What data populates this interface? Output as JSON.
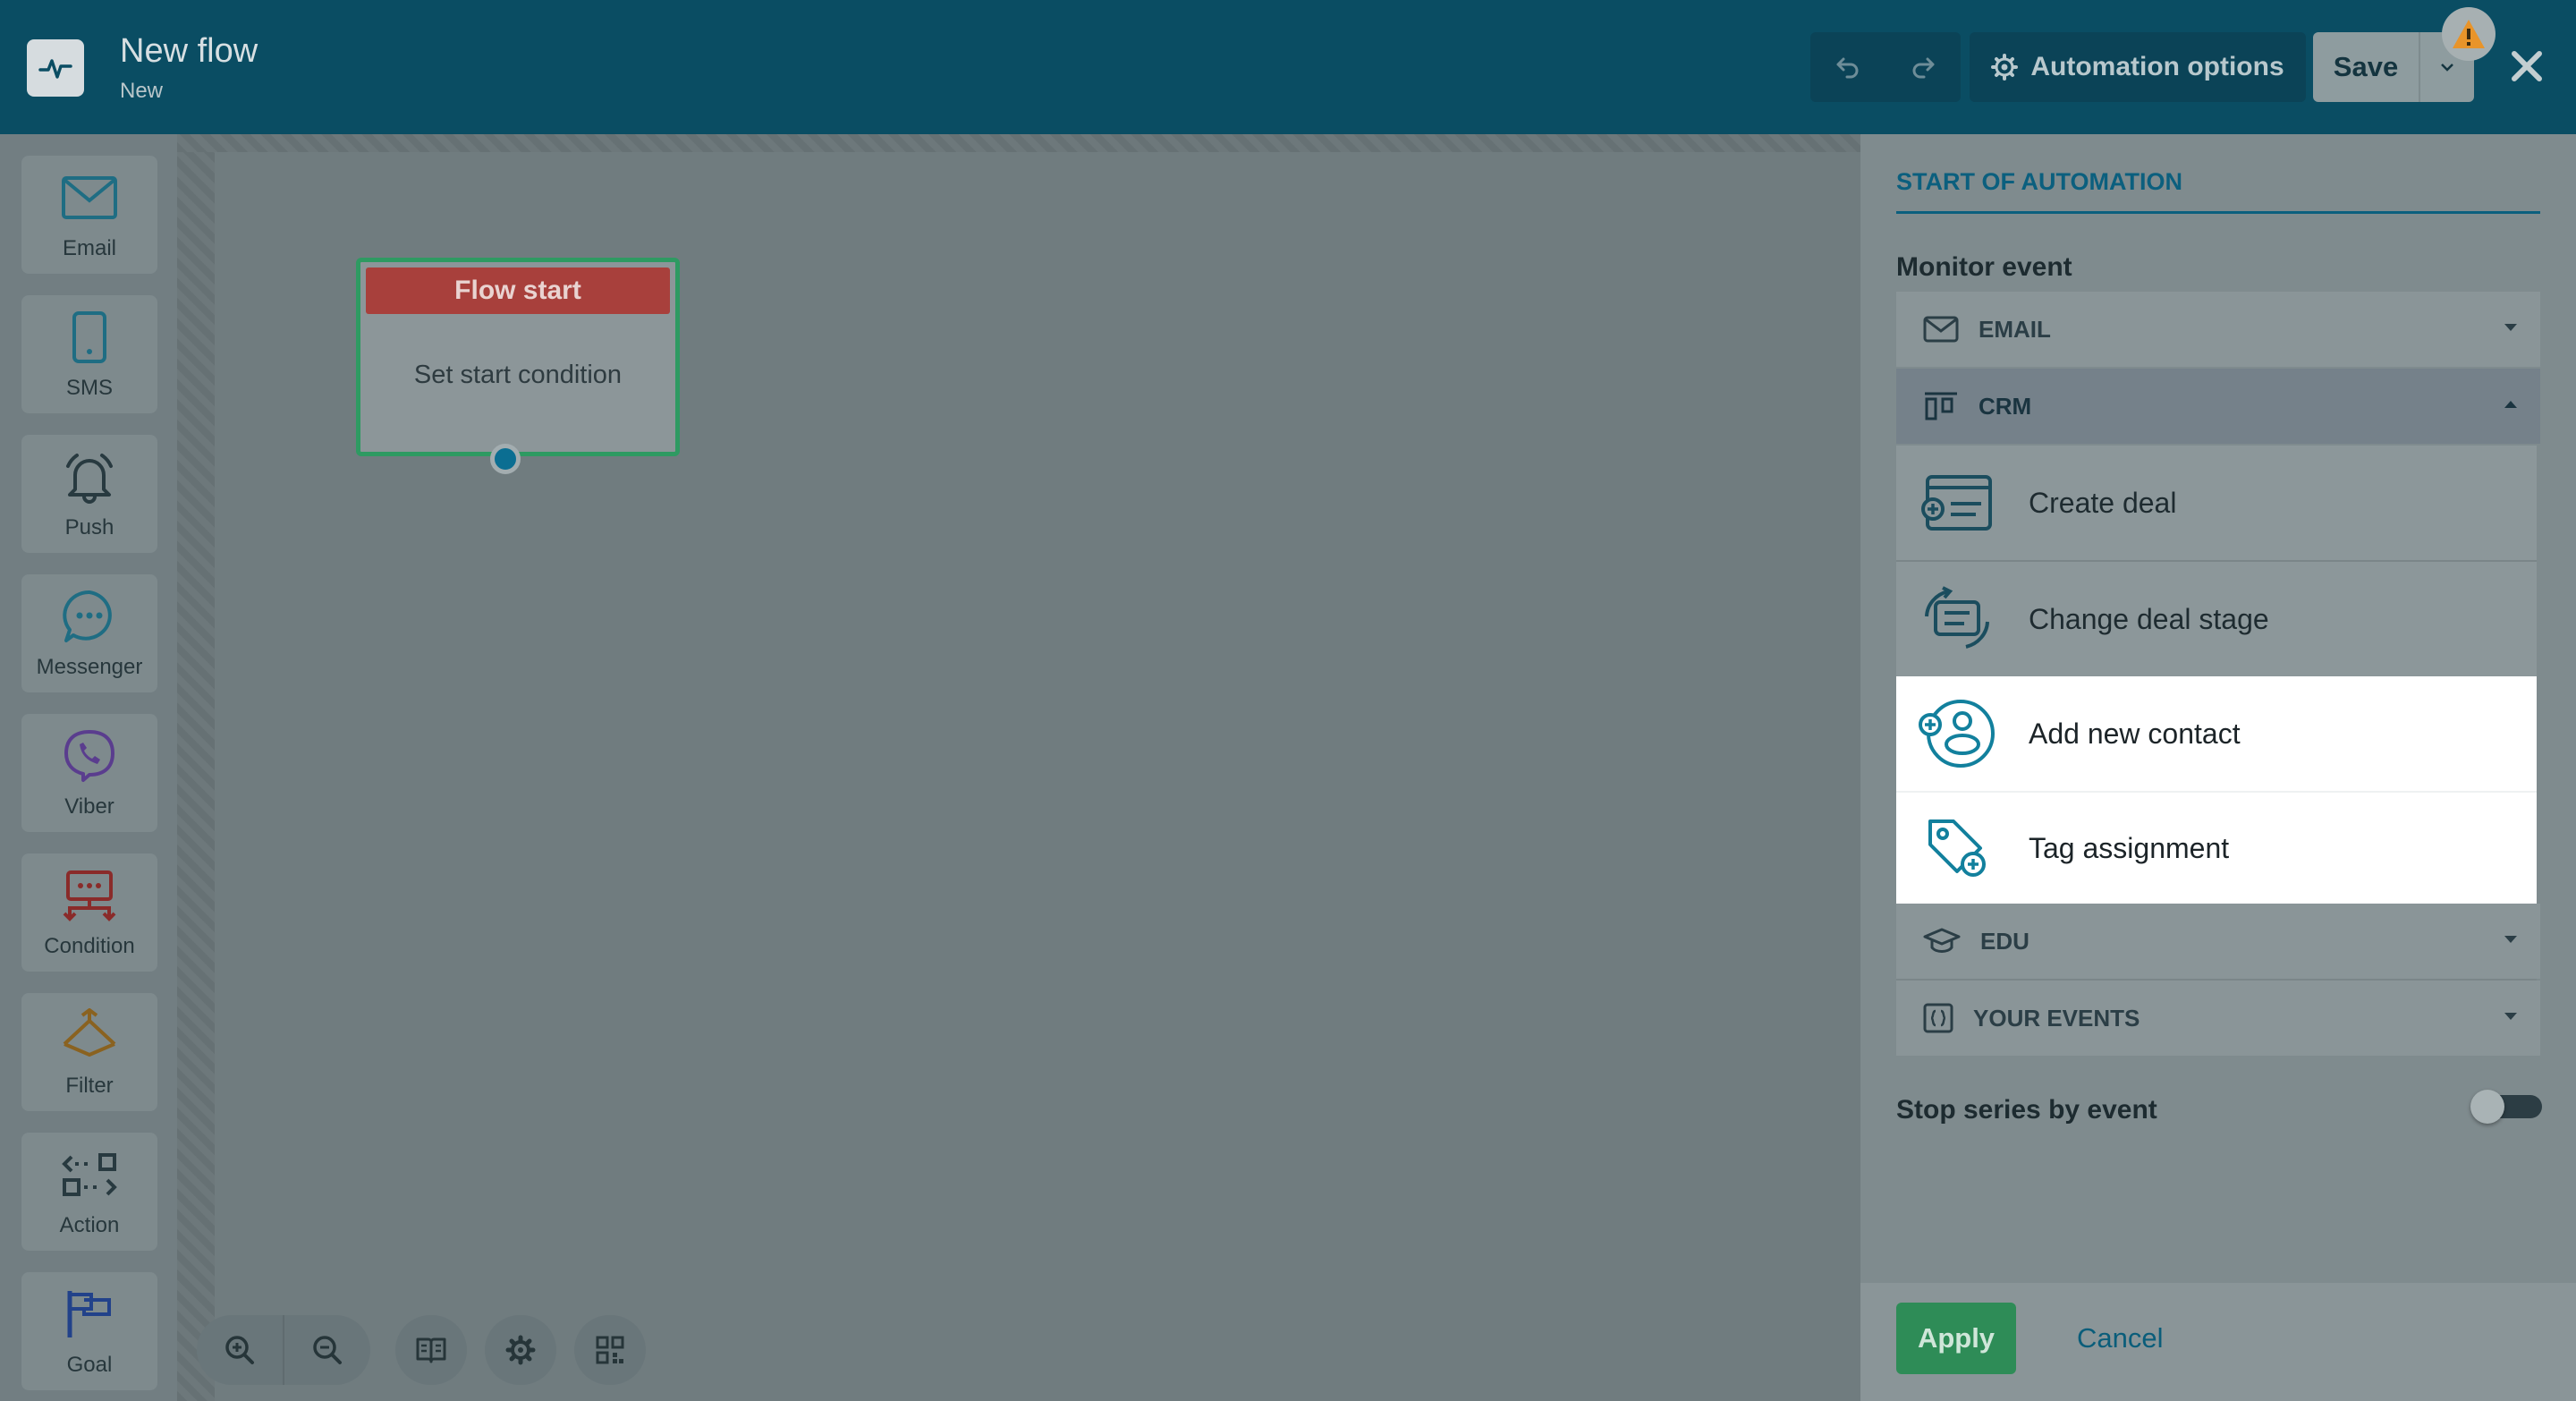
{
  "header": {
    "title": "New flow",
    "subtitle": "New",
    "automation_options_label": "Automation options",
    "save_label": "Save",
    "icons": {
      "logo": "pulse-icon",
      "undo": "undo-icon",
      "redo": "redo-icon",
      "options": "gear-icon",
      "save_dropdown": "chevron-down-icon",
      "warning": "warning-icon",
      "close": "close-icon"
    }
  },
  "toolbar": {
    "items": [
      {
        "label": "Email",
        "icon": "envelope-icon"
      },
      {
        "label": "SMS",
        "icon": "phone-icon"
      },
      {
        "label": "Push",
        "icon": "bell-icon"
      },
      {
        "label": "Messenger",
        "icon": "chat-bubble-icon"
      },
      {
        "label": "Viber",
        "icon": "viber-icon"
      },
      {
        "label": "Condition",
        "icon": "condition-icon"
      },
      {
        "label": "Filter",
        "icon": "filter-icon"
      },
      {
        "label": "Action",
        "icon": "action-icon"
      },
      {
        "label": "Goal",
        "icon": "flag-icon"
      }
    ]
  },
  "canvas": {
    "node": {
      "title": "Flow start",
      "body": "Set start condition"
    },
    "controls": [
      "zoom-in-icon",
      "zoom-out-icon",
      "book-icon",
      "gear-icon",
      "grid-icon"
    ]
  },
  "panel": {
    "title": "START OF AUTOMATION",
    "monitor_event_label": "Monitor event",
    "categories": [
      {
        "label": "EMAIL",
        "icon": "envelope-icon",
        "expanded": false
      },
      {
        "label": "CRM",
        "icon": "kanban-icon",
        "expanded": true
      },
      {
        "label": "EDU",
        "icon": "graduation-cap-icon",
        "expanded": false
      },
      {
        "label": "YOUR EVENTS",
        "icon": "braces-icon",
        "expanded": false
      }
    ],
    "crm_events": [
      {
        "label": "Create deal",
        "icon": "deal-card-icon"
      },
      {
        "label": "Change deal stage",
        "icon": "deal-stage-icon"
      },
      {
        "label": "Add new contact",
        "icon": "add-contact-icon"
      },
      {
        "label": "Tag assignment",
        "icon": "tag-add-icon"
      }
    ],
    "stop_series_label": "Stop series by event",
    "stop_series_enabled": false,
    "apply_label": "Apply",
    "cancel_label": "Cancel"
  },
  "colors": {
    "header_bg": "#0a4d63",
    "accent_teal": "#0b5f7e",
    "node_header_red": "#a8403c",
    "node_border_green": "#2e9a62",
    "apply_green": "#2e8c57",
    "warning_orange": "#e8942a"
  }
}
